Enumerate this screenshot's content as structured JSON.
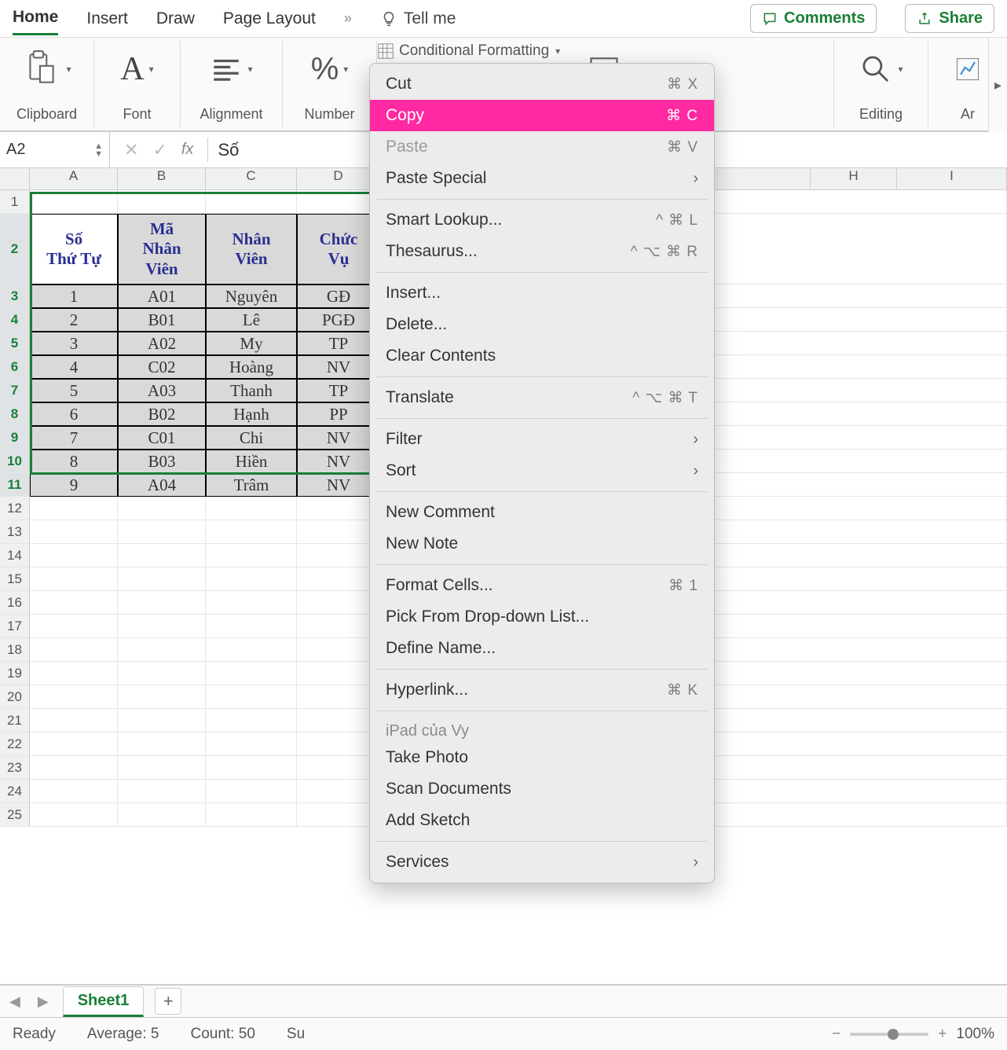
{
  "tabs": {
    "items": [
      "Home",
      "Insert",
      "Draw",
      "Page Layout"
    ],
    "active_index": 0,
    "more_indicator": "»",
    "tell_me": "Tell me"
  },
  "header_buttons": {
    "comments": "Comments",
    "share": "Share"
  },
  "ribbon_groups": {
    "clipboard": "Clipboard",
    "font": "Font",
    "alignment": "Alignment",
    "number": "Number",
    "conditional_formatting": "Conditional Formatting",
    "editing": "Editing",
    "analyze_prefix": "Ar"
  },
  "formula_bar": {
    "name_box": "A2",
    "fx_label": "fx",
    "formula_text": "Số"
  },
  "columns": [
    "A",
    "B",
    "C",
    "D",
    "H",
    "I"
  ],
  "visible_row_numbers": [
    1,
    2,
    3,
    4,
    5,
    6,
    7,
    8,
    9,
    10,
    11,
    12,
    13,
    14,
    15,
    16,
    17,
    18,
    19,
    20,
    21,
    22,
    23,
    24,
    25
  ],
  "selected_row_headers": [
    2,
    3,
    4,
    5,
    6,
    7,
    8,
    9,
    10,
    11
  ],
  "table": {
    "headers": [
      "Số\nThứ Tự",
      "Mã\nNhân\nViên",
      "Nhân\nViên",
      "Chức\nVụ"
    ],
    "rows": [
      [
        "1",
        "A01",
        "Nguyên",
        "GĐ"
      ],
      [
        "2",
        "B01",
        "Lê",
        "PGĐ"
      ],
      [
        "3",
        "A02",
        "My",
        "TP"
      ],
      [
        "4",
        "C02",
        "Hoàng",
        "NV"
      ],
      [
        "5",
        "A03",
        "Thanh",
        "TP"
      ],
      [
        "6",
        "B02",
        "Hạnh",
        "PP"
      ],
      [
        "7",
        "C01",
        "Chi",
        "NV"
      ],
      [
        "8",
        "B03",
        "Hiền",
        "NV"
      ],
      [
        "9",
        "A04",
        "Trâm",
        "NV"
      ]
    ]
  },
  "context_menu": {
    "cut": {
      "label": "Cut",
      "shortcut": "⌘ X",
      "disabled": false
    },
    "copy": {
      "label": "Copy",
      "shortcut": "⌘ C",
      "disabled": false,
      "highlight": true
    },
    "paste": {
      "label": "Paste",
      "shortcut": "⌘ V",
      "disabled": true
    },
    "paste_special": {
      "label": "Paste Special",
      "submenu": true
    },
    "smart_lookup": {
      "label": "Smart Lookup...",
      "shortcut": "^ ⌘ L"
    },
    "thesaurus": {
      "label": "Thesaurus...",
      "shortcut": "^ ⌥ ⌘ R"
    },
    "insert": {
      "label": "Insert..."
    },
    "delete": {
      "label": "Delete..."
    },
    "clear_contents": {
      "label": "Clear Contents"
    },
    "translate": {
      "label": "Translate",
      "shortcut": "^ ⌥ ⌘ T"
    },
    "filter": {
      "label": "Filter",
      "submenu": true
    },
    "sort": {
      "label": "Sort",
      "submenu": true
    },
    "new_comment": {
      "label": "New Comment"
    },
    "new_note": {
      "label": "New Note"
    },
    "format_cells": {
      "label": "Format Cells...",
      "shortcut": "⌘ 1"
    },
    "pick_list": {
      "label": "Pick From Drop-down List..."
    },
    "define_name": {
      "label": "Define Name..."
    },
    "hyperlink": {
      "label": "Hyperlink...",
      "shortcut": "⌘ K"
    },
    "device_section": {
      "label": "iPad của Vy"
    },
    "take_photo": {
      "label": "Take Photo"
    },
    "scan_documents": {
      "label": "Scan Documents"
    },
    "add_sketch": {
      "label": "Add Sketch"
    },
    "services": {
      "label": "Services",
      "submenu": true
    }
  },
  "sheet_tabs": {
    "active": "Sheet1"
  },
  "status_bar": {
    "state": "Ready",
    "average_label": "Average:",
    "average_value": "5",
    "count_label": "Count:",
    "count_value": "50",
    "sum_prefix": "Su",
    "zoom": "100%"
  }
}
